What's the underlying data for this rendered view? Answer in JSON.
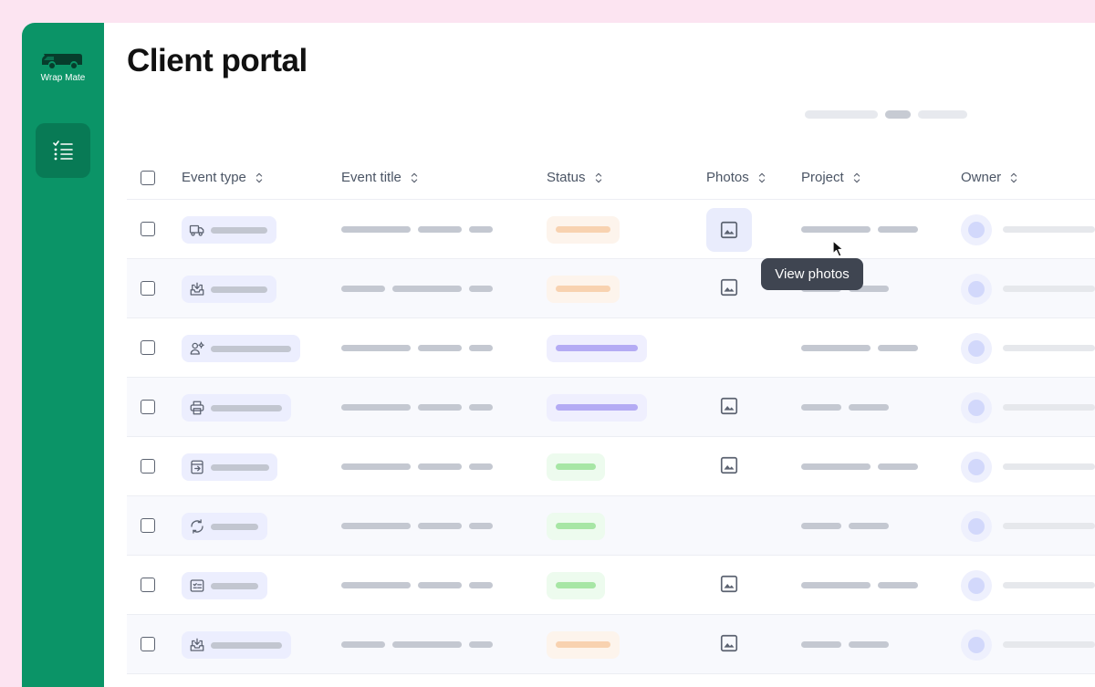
{
  "brand": {
    "name": "Wrap Mate",
    "logo_icon": "van-icon"
  },
  "sidebar": {
    "items": [
      {
        "icon": "checklist-icon",
        "active": true
      }
    ]
  },
  "page": {
    "title": "Client portal"
  },
  "table": {
    "columns": [
      {
        "key": "event_type",
        "label": "Event type"
      },
      {
        "key": "event_title",
        "label": "Event title"
      },
      {
        "key": "status",
        "label": "Status"
      },
      {
        "key": "photos",
        "label": "Photos"
      },
      {
        "key": "project",
        "label": "Project"
      },
      {
        "key": "owner",
        "label": "Owner"
      }
    ],
    "rows": [
      {
        "event_icon": "truck-icon",
        "status_color": "orange",
        "has_photos": true,
        "photo_hovered": true
      },
      {
        "event_icon": "inbox-download-icon",
        "status_color": "orange",
        "has_photos": true
      },
      {
        "event_icon": "user-settings-icon",
        "status_color": "purple",
        "has_photos": false
      },
      {
        "event_icon": "printer-icon",
        "status_color": "purple",
        "has_photos": true
      },
      {
        "event_icon": "export-box-icon",
        "status_color": "green",
        "has_photos": true
      },
      {
        "event_icon": "refresh-icon",
        "status_color": "green",
        "has_photos": false
      },
      {
        "event_icon": "checklist-icon",
        "status_color": "green",
        "has_photos": true
      },
      {
        "event_icon": "inbox-download-icon",
        "status_color": "orange",
        "has_photos": true
      }
    ]
  },
  "status_colors": {
    "orange": {
      "bg": "#fdf4ec",
      "bar": "#f8d2b0"
    },
    "purple": {
      "bg": "#efeffe",
      "bar": "#b4abf4"
    },
    "green": {
      "bg": "#edfbee",
      "bar": "#a7e6a5"
    }
  },
  "tooltip": {
    "text": "View photos"
  },
  "colors": {
    "sidebar": "#0b9467",
    "background": "#fce4f1"
  }
}
